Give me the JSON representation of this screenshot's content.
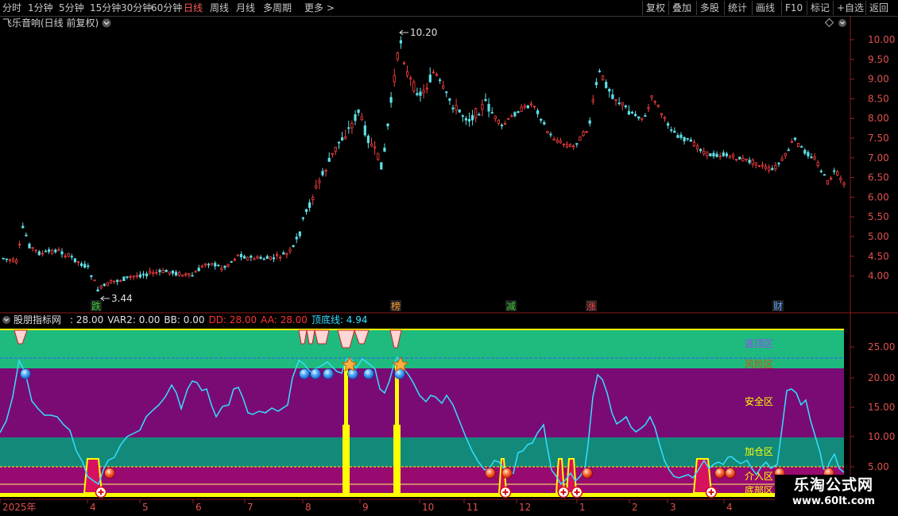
{
  "toolbar": {
    "periods": [
      {
        "label": "分时",
        "active": false
      },
      {
        "label": "1分钟",
        "active": false
      },
      {
        "label": "5分钟",
        "active": false
      },
      {
        "label": "15分钟",
        "active": false
      },
      {
        "label": "30分钟",
        "active": false
      },
      {
        "label": "60分钟",
        "active": false
      },
      {
        "label": "日线",
        "active": true
      },
      {
        "label": "周线",
        "active": false
      },
      {
        "label": "月线",
        "active": false
      },
      {
        "label": "多周期",
        "active": false
      },
      {
        "label": "更多 >",
        "active": false
      }
    ],
    "actions": [
      "复权",
      "叠加",
      "多股",
      "统计",
      "画线",
      "F10",
      "标记",
      "+自选",
      "返回"
    ]
  },
  "price_chart": {
    "title": "飞乐音响(日线 前复权)",
    "y_ticks": [
      "10.00",
      "9.50",
      "9.00",
      "8.50",
      "8.00",
      "7.50",
      "7.00",
      "6.50",
      "6.00",
      "5.50",
      "5.00",
      "4.50",
      "4.00"
    ],
    "high_label": "10.20",
    "low_label": "3.44",
    "markers": [
      {
        "label": "跌",
        "color": "#33cc33"
      },
      {
        "label": "榜",
        "color": "#ff9933"
      },
      {
        "label": "减",
        "color": "#33cc33"
      },
      {
        "label": "涨",
        "color": "#ff4040"
      },
      {
        "label": "财",
        "color": "#5a9cff"
      }
    ]
  },
  "indicator": {
    "name": "股朋指标网",
    "values": [
      {
        "text": ": 28.00",
        "color": "#e0e0e0"
      },
      {
        "text": "VAR2: 0.00",
        "color": "#e0e0e0"
      },
      {
        "text": "BB: 0.00",
        "color": "#e0e0e0"
      },
      {
        "text": "DD: 28.00",
        "color": "#ff3333"
      },
      {
        "text": "AA: 28.00",
        "color": "#ff3333"
      },
      {
        "text": "顶底线: 4.94",
        "color": "#33e0ff"
      }
    ],
    "y_ticks": [
      "25.00",
      "20.00",
      "15.00",
      "10.00",
      "5.00"
    ],
    "zones": [
      {
        "label": "逃顶区",
        "color": "#a040ff"
      },
      {
        "label": "风险区",
        "color": "#cc5500"
      },
      {
        "label": "安全区",
        "color": "#ffff00"
      },
      {
        "label": "加仓区",
        "color": "#ffff00"
      },
      {
        "label": "介入区",
        "color": "#ffff00"
      },
      {
        "label": "底部区",
        "color": "#ffff00"
      }
    ]
  },
  "x_axis": {
    "labels": [
      "2025年",
      "4",
      "5",
      "6",
      "7",
      "8",
      "9",
      "10",
      "11",
      "12",
      "1",
      "2",
      "3",
      "4"
    ]
  },
  "watermark": {
    "title": "乐淘公式网",
    "url": "www.60lt.com"
  },
  "colors": {
    "up": "#ff4040",
    "down": "#5fe0e8",
    "top_band": "#1fba7e",
    "safe_band": "#7a0b75",
    "add_band": "#13897a",
    "bottom_band": "#990a70",
    "line": "#33e0ff",
    "bar": "#ffff00"
  }
}
